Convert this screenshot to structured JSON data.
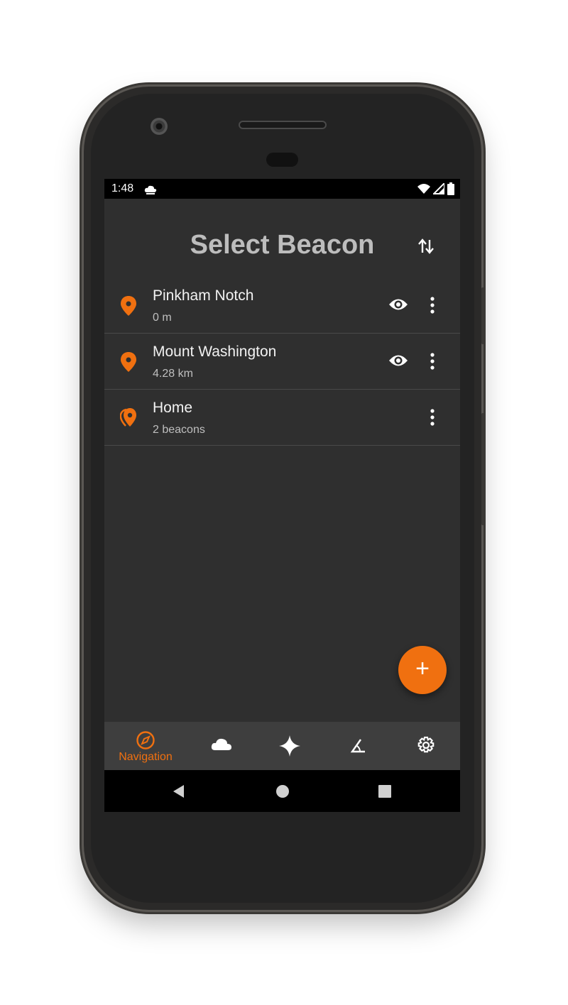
{
  "status_bar": {
    "time": "1:48"
  },
  "header": {
    "title": "Select Beacon"
  },
  "beacons": [
    {
      "name": "Pinkham Notch",
      "subtitle": "0 m",
      "visible_toggle": true,
      "icon": "location-pin-icon"
    },
    {
      "name": "Mount Washington",
      "subtitle": "4.28 km",
      "visible_toggle": true,
      "icon": "location-pin-icon"
    },
    {
      "name": "Home",
      "subtitle": "2 beacons",
      "visible_toggle": false,
      "icon": "beacon-group-icon"
    }
  ],
  "fab": {
    "label": "+"
  },
  "bottom_nav": {
    "items": [
      {
        "label": "Navigation",
        "icon": "compass-icon",
        "active": true
      },
      {
        "label": "",
        "icon": "cloud-icon",
        "active": false
      },
      {
        "label": "",
        "icon": "sparkle-icon",
        "active": false
      },
      {
        "label": "",
        "icon": "angle-icon",
        "active": false
      },
      {
        "label": "",
        "icon": "gear-icon",
        "active": false
      }
    ]
  },
  "colors": {
    "accent": "#f07010",
    "background": "#2f2f2f",
    "nav_background": "#3e3e3e"
  }
}
